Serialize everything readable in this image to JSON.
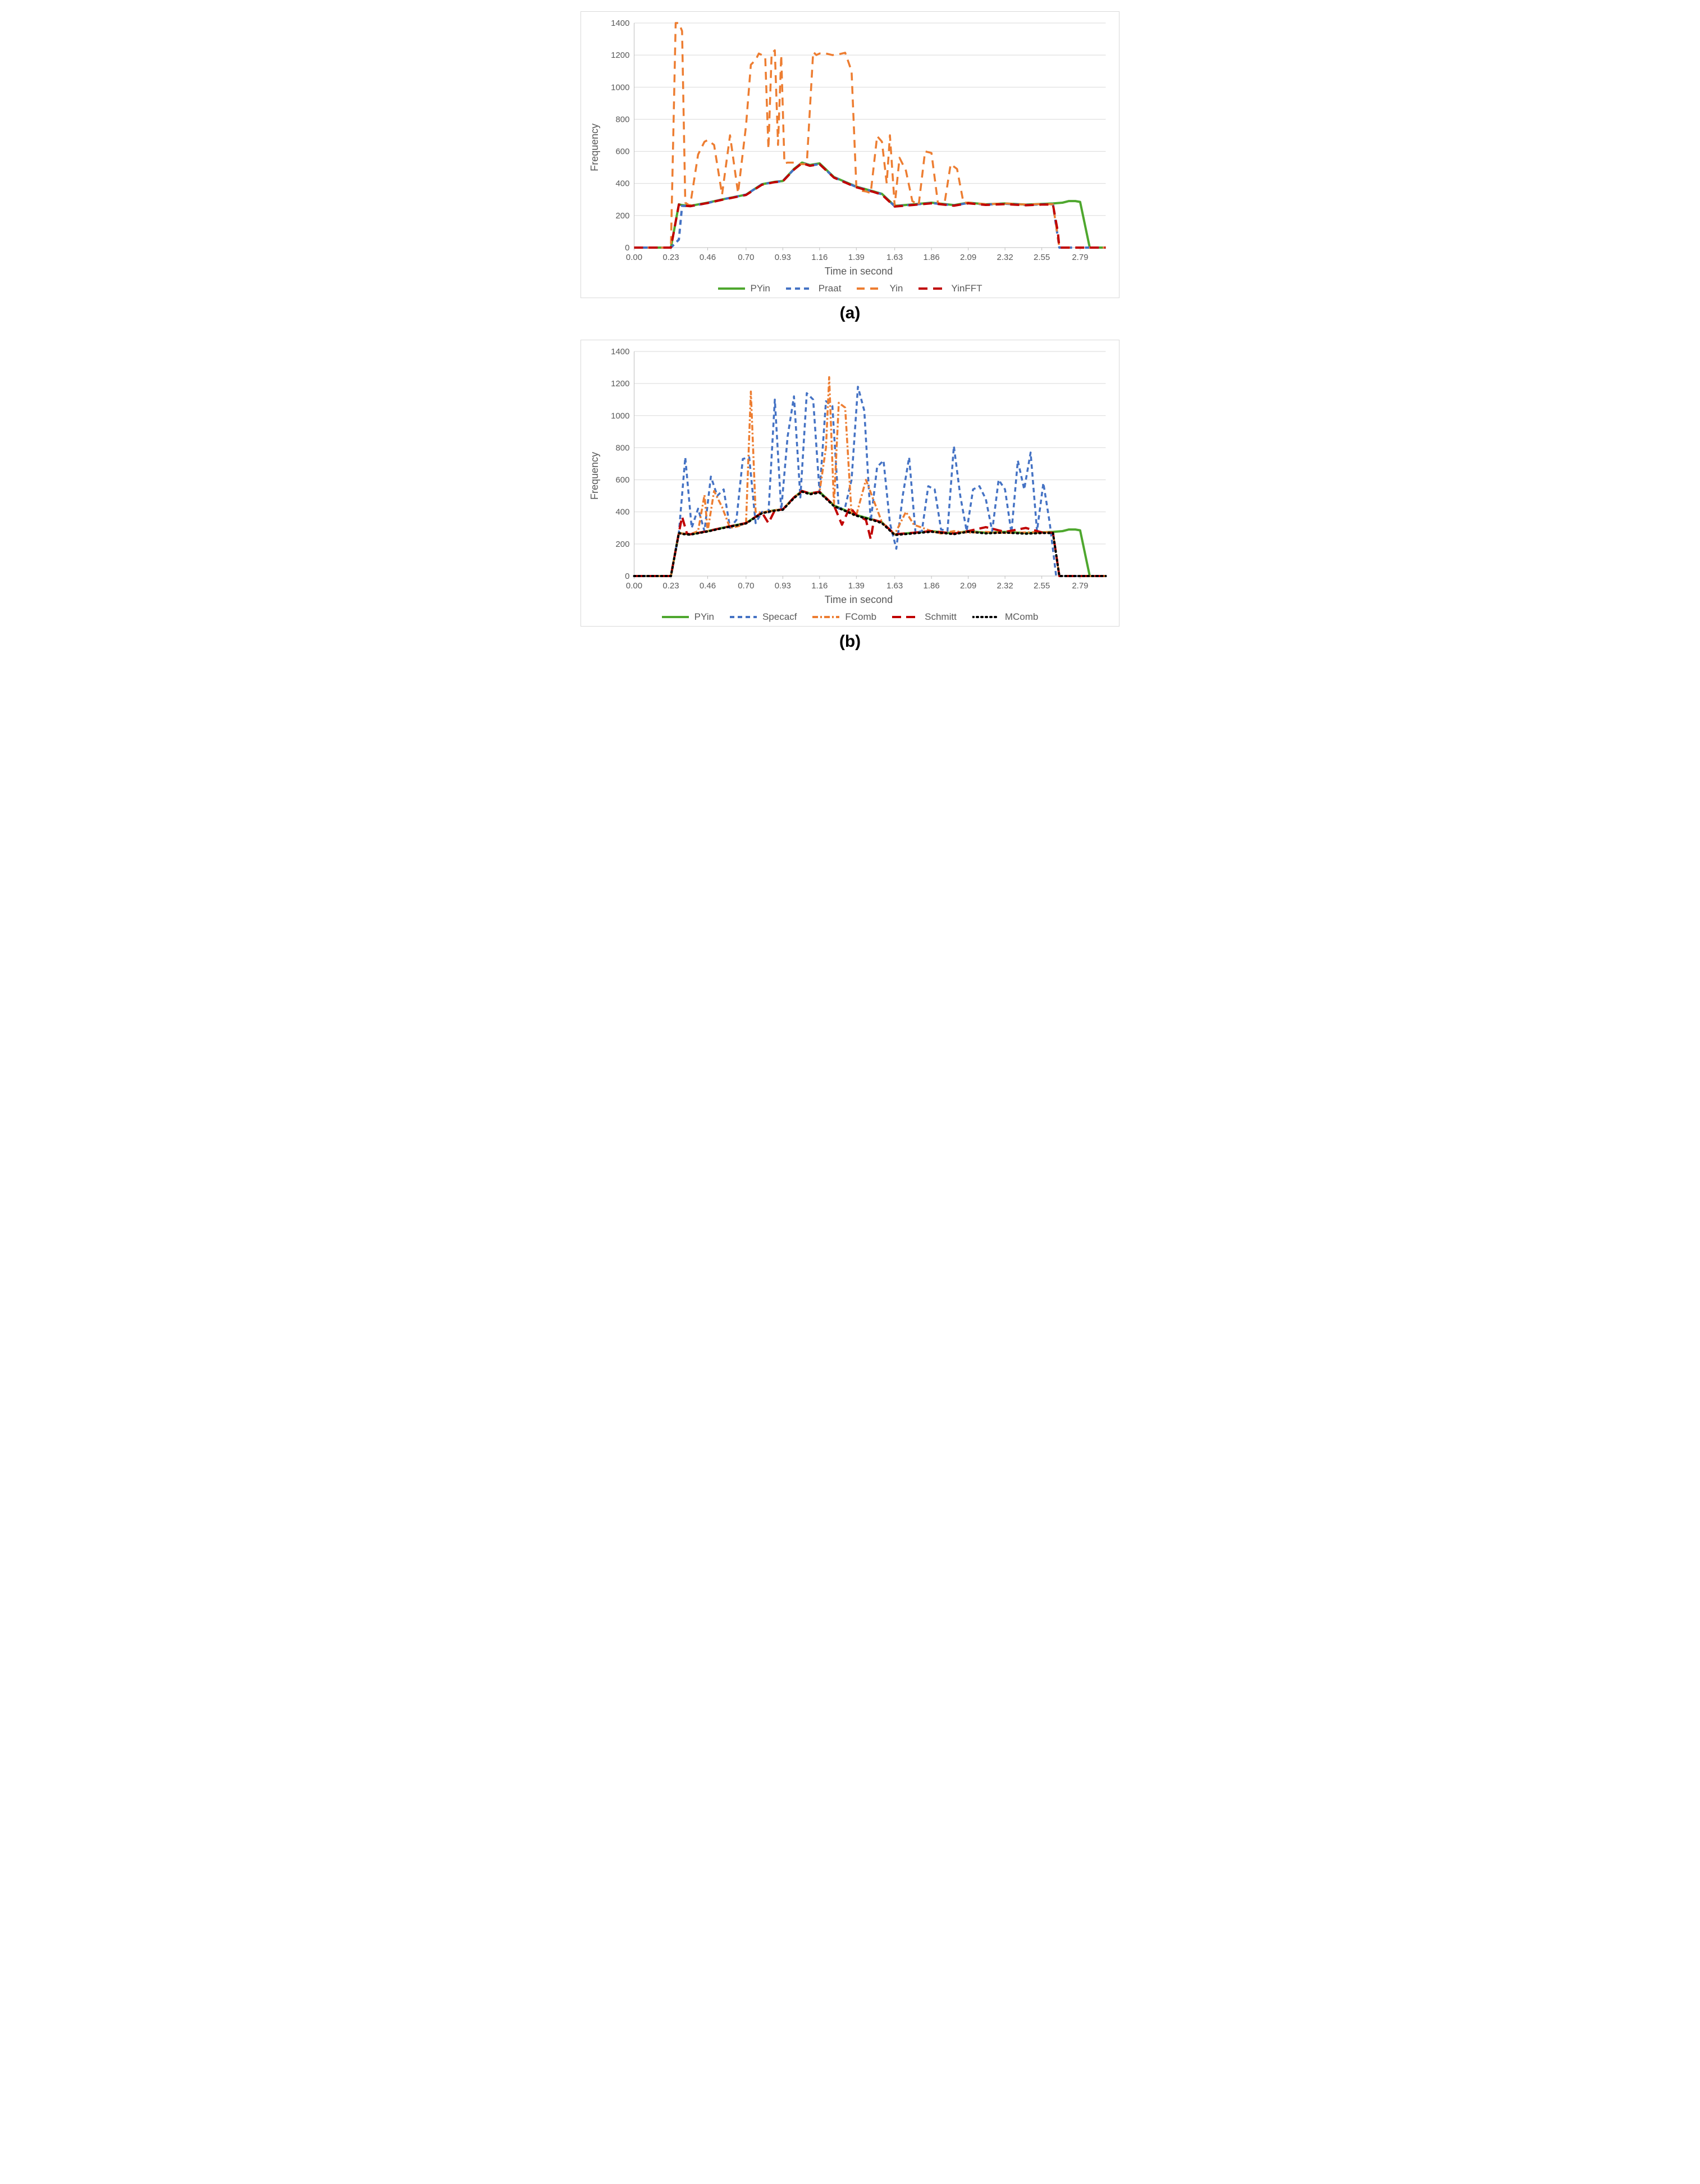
{
  "chart_data": [
    {
      "id": "a",
      "type": "line",
      "subcaption": "(a)",
      "xlabel": "Time in second",
      "ylabel": "Frequency",
      "ylim": [
        0,
        1400
      ],
      "yticks": [
        0,
        200,
        400,
        600,
        800,
        1000,
        1200,
        1400
      ],
      "xlim": [
        0.0,
        2.95
      ],
      "xticks": [
        0.0,
        0.23,
        0.46,
        0.7,
        0.93,
        1.16,
        1.39,
        1.63,
        1.86,
        2.09,
        2.32,
        2.55,
        2.79
      ],
      "xtick_labels": [
        "0.00",
        "0.23",
        "0.46",
        "0.70",
        "0.93",
        "1.16",
        "1.39",
        "1.63",
        "1.86",
        "2.09",
        "2.32",
        "2.55",
        "2.79"
      ],
      "series": [
        {
          "name": "PYin",
          "color": "#4EA72E",
          "style": "solid",
          "width": 4,
          "x": [
            0.0,
            0.23,
            0.28,
            0.3,
            0.35,
            0.46,
            0.55,
            0.7,
            0.8,
            0.88,
            0.93,
            1.0,
            1.05,
            1.1,
            1.16,
            1.25,
            1.39,
            1.5,
            1.55,
            1.63,
            1.75,
            1.86,
            2.0,
            2.09,
            2.2,
            2.32,
            2.45,
            2.55,
            2.62,
            2.68,
            2.72,
            2.76,
            2.79,
            2.85,
            2.95
          ],
          "y": [
            0,
            0,
            270,
            265,
            260,
            280,
            300,
            330,
            395,
            410,
            415,
            490,
            530,
            515,
            525,
            440,
            380,
            350,
            335,
            260,
            270,
            280,
            265,
            280,
            270,
            275,
            268,
            272,
            275,
            280,
            290,
            290,
            285,
            0,
            0
          ]
        },
        {
          "name": "Praat",
          "color": "#4472C4",
          "style": "dashed",
          "dash": "9 7",
          "width": 4,
          "x": [
            0.0,
            0.23,
            0.28,
            0.3,
            0.35,
            0.46,
            0.55,
            0.7,
            0.8,
            0.88,
            0.93,
            1.0,
            1.05,
            1.1,
            1.16,
            1.25,
            1.39,
            1.5,
            1.55,
            1.63,
            1.75,
            1.86,
            2.0,
            2.09,
            2.2,
            2.32,
            2.45,
            2.55,
            2.62,
            2.66,
            2.95
          ],
          "y": [
            0,
            0,
            50,
            260,
            258,
            278,
            300,
            330,
            395,
            408,
            415,
            488,
            528,
            512,
            520,
            438,
            378,
            348,
            332,
            258,
            268,
            278,
            263,
            278,
            268,
            273,
            266,
            270,
            270,
            0,
            0
          ]
        },
        {
          "name": "Yin",
          "color": "#ED7D31",
          "style": "dashed",
          "dash": "14 10",
          "width": 3.5,
          "x": [
            0.0,
            0.23,
            0.26,
            0.28,
            0.3,
            0.32,
            0.35,
            0.4,
            0.44,
            0.46,
            0.5,
            0.55,
            0.6,
            0.65,
            0.7,
            0.73,
            0.76,
            0.78,
            0.82,
            0.84,
            0.86,
            0.88,
            0.9,
            0.92,
            0.94,
            0.96,
            1.0,
            1.04,
            1.08,
            1.12,
            1.14,
            1.16,
            1.2,
            1.24,
            1.28,
            1.32,
            1.36,
            1.39,
            1.42,
            1.45,
            1.48,
            1.52,
            1.55,
            1.58,
            1.6,
            1.63,
            1.66,
            1.7,
            1.74,
            1.78,
            1.82,
            1.86,
            1.9,
            1.94,
            1.98,
            2.02,
            2.06,
            2.09,
            2.2,
            2.32,
            2.45,
            2.55,
            2.62,
            2.66,
            2.95
          ],
          "y": [
            0,
            0,
            1400,
            1400,
            1350,
            280,
            260,
            580,
            660,
            670,
            640,
            330,
            700,
            340,
            760,
            1140,
            1170,
            1210,
            1190,
            615,
            1210,
            1230,
            640,
            1200,
            525,
            530,
            530,
            520,
            520,
            1220,
            1200,
            1210,
            1210,
            1200,
            1205,
            1215,
            1100,
            380,
            355,
            350,
            340,
            695,
            660,
            400,
            700,
            260,
            560,
            480,
            290,
            265,
            600,
            590,
            280,
            265,
            520,
            490,
            280,
            280,
            270,
            275,
            268,
            272,
            270,
            0,
            0
          ]
        },
        {
          "name": "YinFFT",
          "color": "#C00000",
          "style": "dashed",
          "dash": "16 10",
          "width": 4,
          "x": [
            0.0,
            0.23,
            0.28,
            0.3,
            0.35,
            0.46,
            0.55,
            0.7,
            0.8,
            0.88,
            0.93,
            1.0,
            1.05,
            1.1,
            1.16,
            1.25,
            1.39,
            1.5,
            1.55,
            1.63,
            1.75,
            1.86,
            2.0,
            2.09,
            2.2,
            2.32,
            2.45,
            2.55,
            2.62,
            2.65,
            2.66,
            2.95
          ],
          "y": [
            0,
            0,
            268,
            262,
            258,
            278,
            298,
            328,
            392,
            408,
            413,
            486,
            526,
            510,
            520,
            436,
            376,
            346,
            330,
            256,
            266,
            276,
            261,
            276,
            266,
            271,
            264,
            268,
            268,
            100,
            0,
            0
          ]
        }
      ]
    },
    {
      "id": "b",
      "type": "line",
      "subcaption": "(b)",
      "xlabel": "Time in second",
      "ylabel": "Frequency",
      "ylim": [
        0,
        1400
      ],
      "yticks": [
        0,
        200,
        400,
        600,
        800,
        1000,
        1200,
        1400
      ],
      "xlim": [
        0.0,
        2.95
      ],
      "xticks": [
        0.0,
        0.23,
        0.46,
        0.7,
        0.93,
        1.16,
        1.39,
        1.63,
        1.86,
        2.09,
        2.32,
        2.55,
        2.79
      ],
      "xtick_labels": [
        "0.00",
        "0.23",
        "0.46",
        "0.70",
        "0.93",
        "1.16",
        "1.39",
        "1.63",
        "1.86",
        "2.09",
        "2.32",
        "2.55",
        "2.79"
      ],
      "series": [
        {
          "name": "PYin",
          "color": "#4EA72E",
          "style": "solid",
          "width": 4,
          "x": [
            0.0,
            0.23,
            0.28,
            0.3,
            0.35,
            0.46,
            0.55,
            0.7,
            0.8,
            0.88,
            0.93,
            1.0,
            1.05,
            1.1,
            1.16,
            1.25,
            1.39,
            1.5,
            1.55,
            1.63,
            1.75,
            1.86,
            2.0,
            2.09,
            2.2,
            2.32,
            2.45,
            2.55,
            2.62,
            2.68,
            2.72,
            2.76,
            2.79,
            2.85,
            2.95
          ],
          "y": [
            0,
            0,
            270,
            265,
            260,
            280,
            300,
            330,
            395,
            410,
            415,
            490,
            530,
            515,
            525,
            440,
            380,
            350,
            335,
            260,
            270,
            280,
            265,
            280,
            270,
            275,
            268,
            272,
            275,
            280,
            290,
            290,
            285,
            0,
            0
          ]
        },
        {
          "name": "Specacf",
          "color": "#4472C4",
          "style": "dashed",
          "dash": "8 6",
          "width": 3.5,
          "x": [
            0.0,
            0.23,
            0.28,
            0.32,
            0.36,
            0.4,
            0.44,
            0.48,
            0.52,
            0.56,
            0.6,
            0.64,
            0.68,
            0.72,
            0.76,
            0.8,
            0.84,
            0.88,
            0.92,
            0.96,
            1.0,
            1.04,
            1.08,
            1.12,
            1.16,
            1.2,
            1.24,
            1.28,
            1.32,
            1.36,
            1.4,
            1.44,
            1.48,
            1.52,
            1.56,
            1.6,
            1.64,
            1.68,
            1.72,
            1.76,
            1.8,
            1.84,
            1.88,
            1.92,
            1.96,
            2.0,
            2.04,
            2.08,
            2.12,
            2.16,
            2.2,
            2.24,
            2.28,
            2.32,
            2.36,
            2.4,
            2.44,
            2.48,
            2.52,
            2.56,
            2.6,
            2.64,
            2.95
          ],
          "y": [
            0,
            0,
            270,
            740,
            300,
            420,
            280,
            620,
            500,
            540,
            300,
            350,
            730,
            740,
            330,
            400,
            390,
            1100,
            410,
            870,
            1120,
            490,
            1140,
            1100,
            520,
            1090,
            1060,
            420,
            430,
            600,
            1180,
            1030,
            340,
            680,
            720,
            330,
            170,
            500,
            740,
            270,
            280,
            560,
            540,
            290,
            280,
            810,
            500,
            280,
            540,
            560,
            480,
            280,
            600,
            540,
            270,
            720,
            540,
            770,
            280,
            580,
            330,
            0,
            0
          ]
        },
        {
          "name": "FComb",
          "color": "#ED7D31",
          "style": "dashed",
          "dash": "10 4 3 4",
          "width": 3.5,
          "x": [
            0.0,
            0.23,
            0.28,
            0.3,
            0.35,
            0.4,
            0.44,
            0.46,
            0.5,
            0.55,
            0.6,
            0.65,
            0.7,
            0.73,
            0.76,
            0.8,
            0.88,
            0.93,
            1.0,
            1.05,
            1.1,
            1.16,
            1.2,
            1.22,
            1.25,
            1.28,
            1.32,
            1.36,
            1.39,
            1.45,
            1.55,
            1.63,
            1.7,
            1.75,
            1.86,
            1.92,
            2.0,
            2.09,
            2.2,
            2.32,
            2.45,
            2.55,
            2.62,
            2.66,
            2.95
          ],
          "y": [
            0,
            0,
            270,
            265,
            260,
            280,
            505,
            280,
            530,
            430,
            300,
            310,
            330,
            1150,
            400,
            395,
            410,
            415,
            490,
            530,
            515,
            525,
            800,
            1240,
            445,
            1080,
            1050,
            380,
            380,
            600,
            335,
            260,
            400,
            320,
            280,
            265,
            280,
            270,
            275,
            268,
            272,
            275,
            270,
            0,
            0
          ]
        },
        {
          "name": "Schmitt",
          "color": "#C00000",
          "style": "dashed",
          "dash": "16 9",
          "width": 4,
          "x": [
            0.0,
            0.23,
            0.28,
            0.3,
            0.33,
            0.35,
            0.46,
            0.55,
            0.7,
            0.8,
            0.84,
            0.88,
            0.93,
            1.0,
            1.05,
            1.1,
            1.16,
            1.25,
            1.3,
            1.35,
            1.39,
            1.45,
            1.48,
            1.5,
            1.55,
            1.63,
            1.75,
            1.86,
            2.0,
            2.09,
            2.2,
            2.32,
            2.45,
            2.55,
            2.62,
            2.66,
            2.95
          ],
          "y": [
            0,
            0,
            270,
            370,
            265,
            260,
            280,
            300,
            330,
            395,
            330,
            410,
            415,
            490,
            530,
            515,
            525,
            440,
            320,
            430,
            380,
            350,
            230,
            350,
            335,
            260,
            270,
            280,
            265,
            280,
            305,
            275,
            300,
            272,
            270,
            0,
            0
          ]
        },
        {
          "name": "MComb",
          "color": "#000000",
          "style": "dotted",
          "dash": "2 6",
          "width": 4,
          "x": [
            0.0,
            0.23,
            0.28,
            0.3,
            0.35,
            0.46,
            0.55,
            0.7,
            0.8,
            0.88,
            0.93,
            1.0,
            1.05,
            1.1,
            1.16,
            1.25,
            1.39,
            1.5,
            1.55,
            1.63,
            1.75,
            1.86,
            2.0,
            2.09,
            2.2,
            2.32,
            2.45,
            2.55,
            2.62,
            2.66,
            2.95
          ],
          "y": [
            0,
            0,
            268,
            262,
            258,
            278,
            298,
            328,
            392,
            408,
            413,
            486,
            526,
            510,
            520,
            436,
            376,
            346,
            330,
            256,
            266,
            276,
            261,
            276,
            266,
            271,
            264,
            268,
            268,
            0,
            0
          ]
        }
      ]
    }
  ]
}
